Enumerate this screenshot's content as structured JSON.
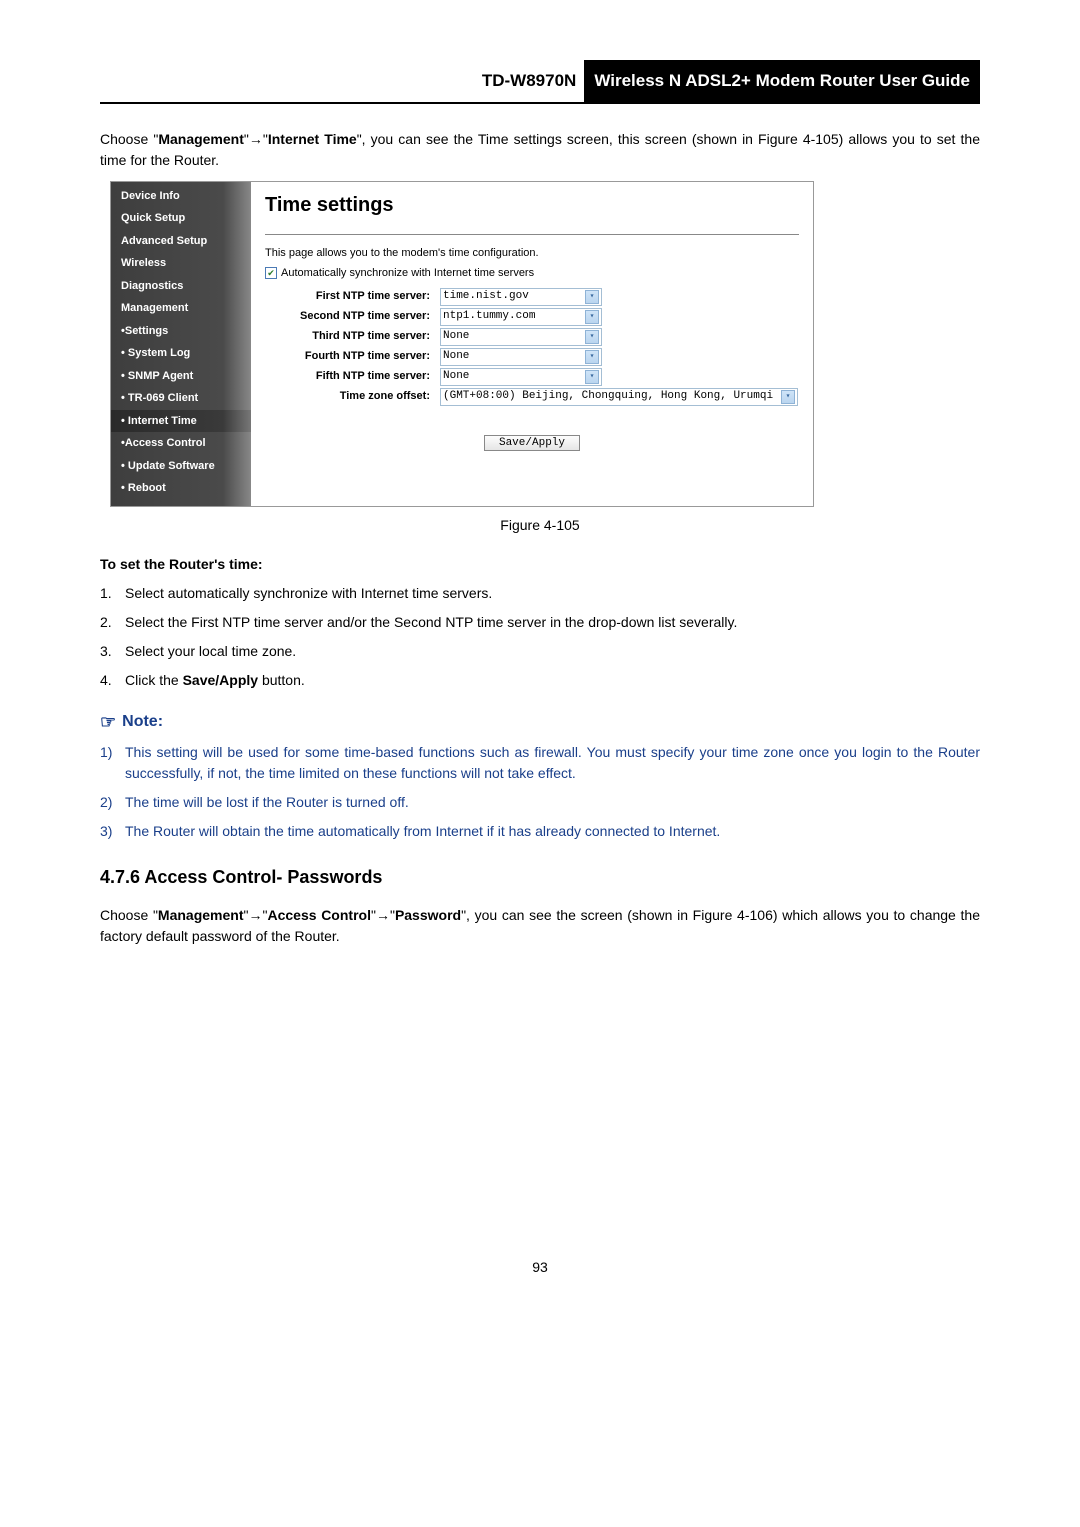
{
  "header": {
    "model": "TD-W8970N",
    "title": "Wireless N ADSL2+ Modem Router User Guide"
  },
  "intro": {
    "pre": "Choose \"",
    "b1": "Management",
    "mid1": "\"",
    "arrow": "→",
    "q2": "\"",
    "b2": "Internet Time",
    "post": "\", you can see the Time settings screen, this screen (shown in Figure 4-105) allows you to set the time for the Router."
  },
  "screenshot": {
    "sidebar": [
      {
        "label": "Device Info",
        "active": false
      },
      {
        "label": "Quick Setup",
        "active": false
      },
      {
        "label": "Advanced Setup",
        "active": false
      },
      {
        "label": "Wireless",
        "active": false
      },
      {
        "label": "Diagnostics",
        "active": false
      },
      {
        "label": "Management",
        "active": false
      },
      {
        "label": "•Settings",
        "active": false
      },
      {
        "label": "• System Log",
        "active": false
      },
      {
        "label": "• SNMP Agent",
        "active": false
      },
      {
        "label": "• TR-069 Client",
        "active": false
      },
      {
        "label": "• Internet Time",
        "active": true
      },
      {
        "label": "•Access Control",
        "active": false
      },
      {
        "label": "• Update Software",
        "active": false
      },
      {
        "label": "• Reboot",
        "active": false
      }
    ],
    "heading": "Time settings",
    "desc": "This page allows you to the modem's time configuration.",
    "checkbox": "Automatically synchronize with Internet time servers",
    "rows": [
      {
        "label": "First NTP time server:",
        "value": "time.nist.gov",
        "wide": false
      },
      {
        "label": "Second NTP time server:",
        "value": "ntp1.tummy.com",
        "wide": false
      },
      {
        "label": "Third NTP time server:",
        "value": "None",
        "wide": false
      },
      {
        "label": "Fourth NTP time server:",
        "value": "None",
        "wide": false
      },
      {
        "label": "Fifth NTP time server:",
        "value": "None",
        "wide": false
      },
      {
        "label": "Time zone offset:",
        "value": "(GMT+08:00) Beijing, Chongquing, Hong Kong, Urumqi",
        "wide": true
      }
    ],
    "button": "Save/Apply"
  },
  "figcaption": "Figure 4-105",
  "subhead": "To set the Router's time:",
  "steps": [
    {
      "n": "1.",
      "t": "Select automatically synchronize with Internet time servers."
    },
    {
      "n": "2.",
      "t": "Select the First NTP time server and/or the Second NTP time server in the drop-down list severally."
    },
    {
      "n": "3.",
      "t": "Select your local time zone."
    },
    {
      "n": "4.",
      "pre": "Click the ",
      "b": "Save/Apply",
      "post": " button."
    }
  ],
  "note_head": "Note:",
  "notes": [
    {
      "n": "1)",
      "t": "This setting will be used for some time-based functions such as firewall. You must specify your time zone once you login to the Router successfully, if not, the time limited on these functions will not take effect."
    },
    {
      "n": "2)",
      "t": "The time will be lost if the Router is turned off."
    },
    {
      "n": "3)",
      "t": "The Router will obtain the time automatically from Internet if it has already connected to Internet."
    }
  ],
  "section": "4.7.6  Access Control- Passwords",
  "para2": {
    "pre": "Choose \"",
    "b1": "Management",
    "m1": "\"",
    "arrow": "→",
    "q2": "\"",
    "b2": "Access Control",
    "m2": "\"",
    "q3": "\"",
    "b3": "Password",
    "post": "\", you can see the screen (shown in Figure 4-106) which allows you to change the factory default password of the Router."
  },
  "page_num": "93"
}
